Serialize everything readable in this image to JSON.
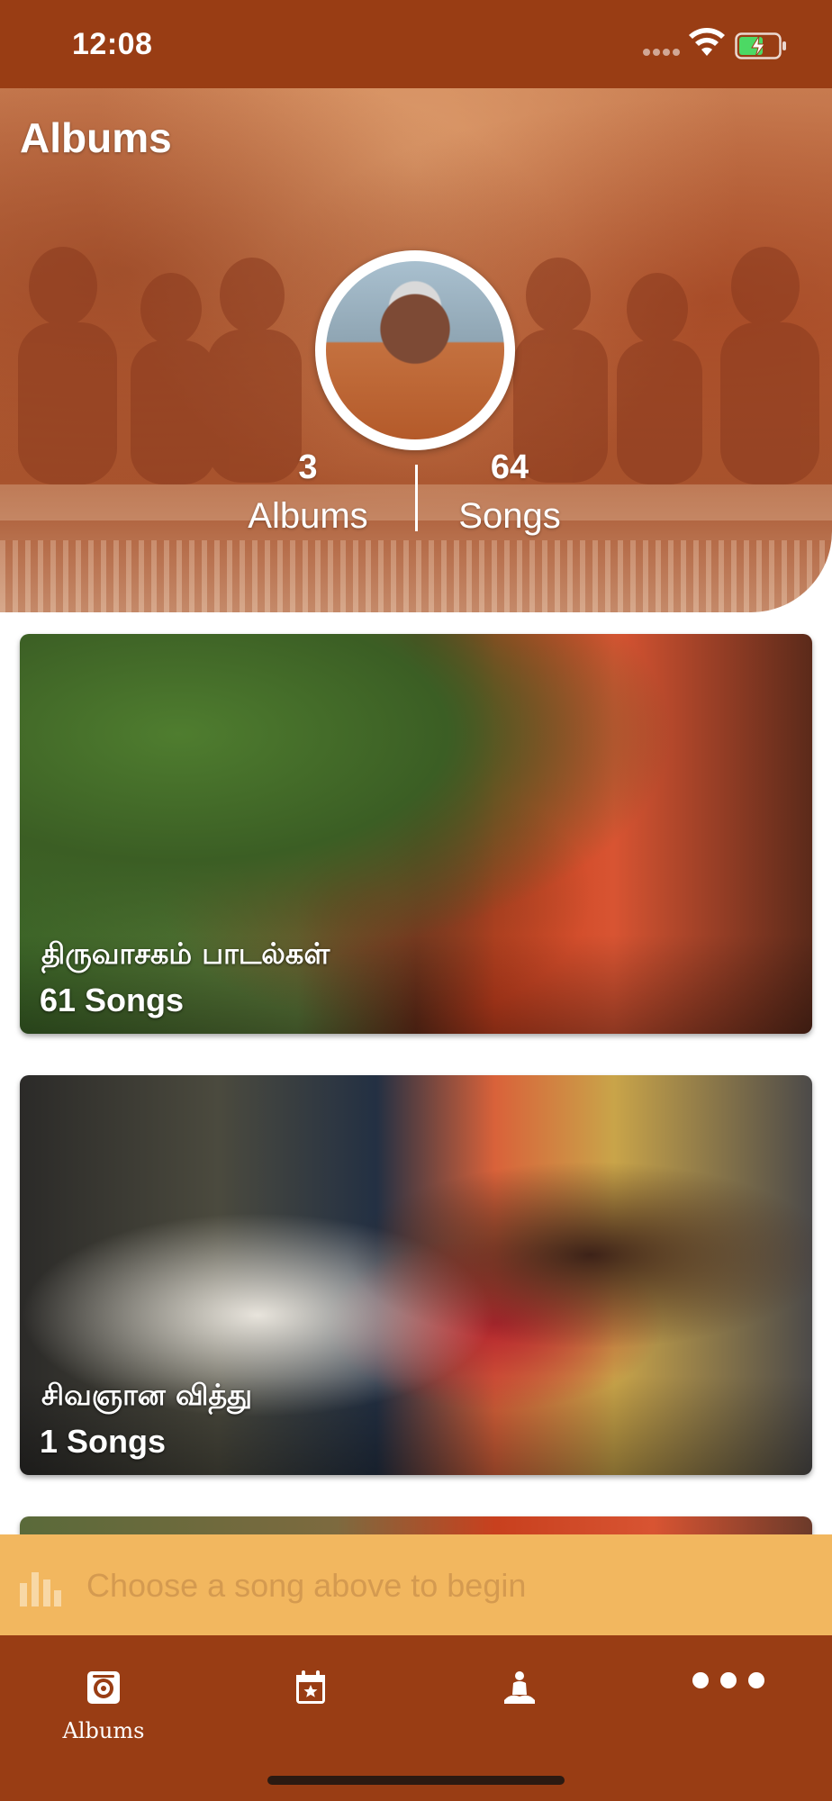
{
  "status_bar": {
    "time": "12:08",
    "wifi_icon": "wifi-icon",
    "battery_icon": "battery-charging-icon"
  },
  "header": {
    "title": "Albums",
    "avatar": "artist-avatar",
    "stats": [
      {
        "value": "3",
        "label": "Albums"
      },
      {
        "value": "64",
        "label": "Songs"
      }
    ]
  },
  "albums": [
    {
      "title": "திருவாசகம் பாடல்கள்",
      "count": "61 Songs"
    },
    {
      "title": "சிவஞான வித்து",
      "count": "1 Songs"
    }
  ],
  "mini_player": {
    "icon": "equalizer-icon",
    "text": "Choose a song above to begin"
  },
  "tab_bar": {
    "tabs": [
      {
        "id": "albums",
        "label": "Albums",
        "icon": "album-icon"
      },
      {
        "id": "events",
        "label": "",
        "icon": "calendar-star-icon"
      },
      {
        "id": "profile",
        "label": "",
        "icon": "meditation-icon"
      },
      {
        "id": "more",
        "label": "",
        "icon": "more-dots-icon"
      }
    ]
  },
  "colors": {
    "bar_brown": "#993d14",
    "player_yellow": "#f2b75f",
    "player_text": "#d49a50"
  }
}
